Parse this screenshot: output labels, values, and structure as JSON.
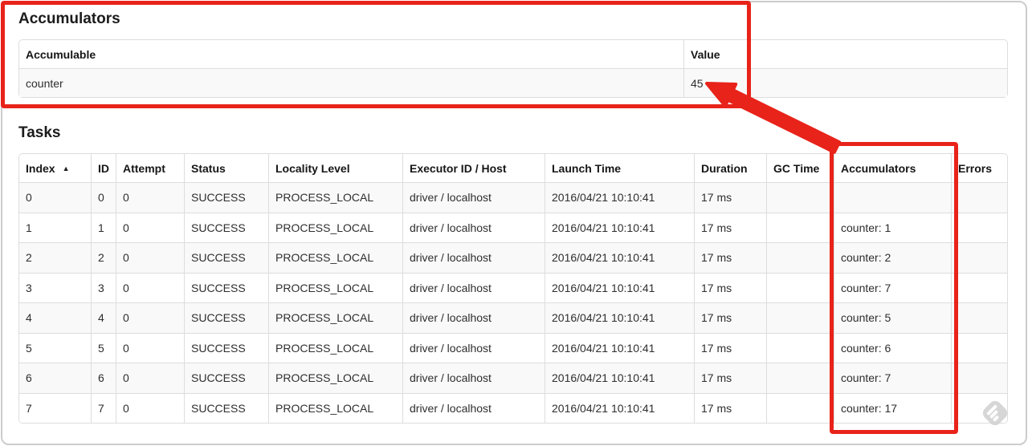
{
  "accumulators_section": {
    "title": "Accumulators",
    "table": {
      "columns": [
        "Accumulable",
        "Value"
      ],
      "rows": [
        [
          "counter",
          "45"
        ]
      ]
    }
  },
  "tasks_section": {
    "title": "Tasks",
    "sorted_column": "Index",
    "table": {
      "columns": [
        "Index",
        "ID",
        "Attempt",
        "Status",
        "Locality Level",
        "Executor ID / Host",
        "Launch Time",
        "Duration",
        "GC Time",
        "Accumulators",
        "Errors"
      ],
      "rows": [
        [
          "0",
          "0",
          "0",
          "SUCCESS",
          "PROCESS_LOCAL",
          "driver / localhost",
          "2016/04/21 10:10:41",
          "17 ms",
          "",
          "",
          ""
        ],
        [
          "1",
          "1",
          "0",
          "SUCCESS",
          "PROCESS_LOCAL",
          "driver / localhost",
          "2016/04/21 10:10:41",
          "17 ms",
          "",
          "counter: 1",
          ""
        ],
        [
          "2",
          "2",
          "0",
          "SUCCESS",
          "PROCESS_LOCAL",
          "driver / localhost",
          "2016/04/21 10:10:41",
          "17 ms",
          "",
          "counter: 2",
          ""
        ],
        [
          "3",
          "3",
          "0",
          "SUCCESS",
          "PROCESS_LOCAL",
          "driver / localhost",
          "2016/04/21 10:10:41",
          "17 ms",
          "",
          "counter: 7",
          ""
        ],
        [
          "4",
          "4",
          "0",
          "SUCCESS",
          "PROCESS_LOCAL",
          "driver / localhost",
          "2016/04/21 10:10:41",
          "17 ms",
          "",
          "counter: 5",
          ""
        ],
        [
          "5",
          "5",
          "0",
          "SUCCESS",
          "PROCESS_LOCAL",
          "driver / localhost",
          "2016/04/21 10:10:41",
          "17 ms",
          "",
          "counter: 6",
          ""
        ],
        [
          "6",
          "6",
          "0",
          "SUCCESS",
          "PROCESS_LOCAL",
          "driver / localhost",
          "2016/04/21 10:10:41",
          "17 ms",
          "",
          "counter: 7",
          ""
        ],
        [
          "7",
          "7",
          "0",
          "SUCCESS",
          "PROCESS_LOCAL",
          "driver / localhost",
          "2016/04/21 10:10:41",
          "17 ms",
          "",
          "counter: 17",
          ""
        ]
      ]
    }
  },
  "icons": {
    "sort_ascending_icon": "▲",
    "feedly_icon": "feedly-badge"
  },
  "annotation": {
    "color": "#e8231a",
    "highlighted_value": "45",
    "highlighted_column": "Accumulators"
  }
}
